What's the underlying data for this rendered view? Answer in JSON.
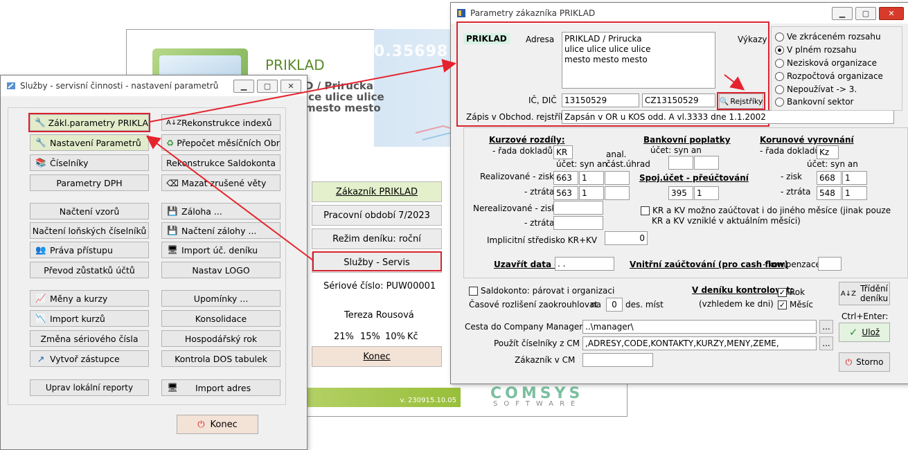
{
  "background": {
    "title": "PRIKLAD",
    "sub1": "D / Prirucka",
    "sub2": "ice ulice ulice",
    "sub3": "mesto mesto",
    "banner_num": "0.35698",
    "buttons": {
      "customer": "Zákazník  PRIKLAD",
      "period": "Pracovní období  7/2023",
      "journal": "Režim deníku: roční",
      "services": "Služby - Servis",
      "close": "Konec"
    },
    "serial_label": "Sériové číslo: PUW00001",
    "user": "Tereza Rousová",
    "rates": [
      "21%",
      "15%",
      "10%",
      "Kč"
    ],
    "version": "v. 230915.10.05",
    "brand": "COMSYS",
    "brand_sub": "SOFTWARE"
  },
  "services": {
    "title": "Služby - servisní činnosti - nastavení parametrů",
    "left_buttons": [
      "Zákl.parametry PRIKLAD",
      "Nastavení Parametrů",
      "Číselníky",
      "Parametry DPH",
      "Načtení vzorů",
      "Načtení loňských číselníků",
      "Práva přístupu",
      "Převod zůstatků účtů",
      "Měny a kurzy",
      "Import kurzů",
      "Změna sériového čísla",
      "Vytvoř zástupce",
      "Uprav lokální reporty"
    ],
    "right_buttons": [
      "Rekonstrukce indexů",
      "Přepočet měsíčních Obra",
      "Rekonstrukce Saldokonta",
      "Mazat zrušené věty",
      "Záloha ...",
      "Načtení zálohy ...",
      "Import úč. deníku",
      "Nastav LOGO",
      "Upomínky ...",
      "Konsolidace",
      "Hospodářský rok",
      "Kontrola DOS tabulek",
      "Import adres"
    ],
    "close": "Konec"
  },
  "params": {
    "title": "Parametry zákazníka PRIKLAD",
    "name_tag": "PRIKLAD",
    "address_label": "Adresa",
    "address_lines": [
      "PRIKLAD / Prirucka",
      "ulice ulice ulice ulice",
      "mesto mesto mesto"
    ],
    "ic_label": "IČ, DIČ",
    "ic": "13150529",
    "dic": "CZ13150529",
    "registers_btn": "Rejstříky",
    "commercial_label": "Zápis v Obchod. rejstříku",
    "commercial_value": "Zapsán v OR u KOS odd. A vl.3333 dne 1.1.2002",
    "reports_label": "Výkazy",
    "reports": [
      "Ve zkráceném rozsahu",
      "V plném rozsahu",
      "Nezisková organizace",
      "Rozpočtová organizace",
      "Nepoužívat -> 3.",
      "Bankovní sektor"
    ],
    "reports_selected": 1,
    "fx": {
      "title": "Kurzové rozdíly:",
      "series_label": "- řada dokladů",
      "series": "KR",
      "acct_hdr": "účet: syn an",
      "anal_hdr1": "anal.",
      "anal_hdr2": "část.úhrad",
      "real_gain_label": "Realizované - zisk",
      "real_gain": [
        "663",
        "1"
      ],
      "real_loss_label": "- ztráta",
      "real_loss": [
        "563",
        "1"
      ],
      "unreal_gain_label": "Nerealizované - zisk",
      "unreal_loss_label": "- ztráta"
    },
    "bank": {
      "title": "Bankovní poplatky",
      "acct_hdr": "účet: syn an",
      "transfer_title": "Spoj.účet - přeúčtování",
      "transfer": [
        "395",
        "1"
      ]
    },
    "rounding": {
      "title": "Korunové vyrovnání",
      "series_label": "- řada dokladů",
      "series": "Kz",
      "acct_hdr": "účet: syn an",
      "gain_label": "- zisk",
      "gain": [
        "668",
        "1"
      ],
      "loss_label": "- ztráta",
      "loss": [
        "548",
        "1"
      ]
    },
    "krkv_line1": "KR a KV možno zaúčtovat i do jiného měsíce (jinak pouze",
    "krkv_line2": "KR a KV vzniklé v aktuálním měsíci)",
    "cost_center_label": "Implicitní středisko KR+KV",
    "cost_center": "0",
    "close_date_label": "Uzavřít data do",
    "close_date": " .  .",
    "internal_label": "Vnitřní zaúčtování (pro cash flow)",
    "compensation_label": "- kompenzace",
    "saldo_label": "Saldokonto: párovat i organizaci",
    "accrual_label": "Časové rozlišení zaokrouhlovat",
    "accrual_na": "na",
    "accrual_value": "0",
    "accrual_unit": "des. míst",
    "journal_check_label": "V deníku kontrolovat:",
    "journal_check_sub": "(vzhledem ke dni)",
    "year_label": "Rok",
    "month_label": "Měsíc",
    "sort_btn_1": "Třídění",
    "sort_btn_2": "deníku",
    "cm_path_label": "Cesta do Company Managera",
    "cm_path": "..\\manager\\",
    "cm_codes_label": "Použít číselníky z CM",
    "cm_codes": ",ADRESY,CODE,KONTAKTY,KURZY,MENY,ZEME,",
    "cm_customer_label": "Zákazník v CM",
    "shortcut": "Ctrl+Enter:",
    "save": "Ulož",
    "cancel": "Storno",
    "browse": "..."
  }
}
